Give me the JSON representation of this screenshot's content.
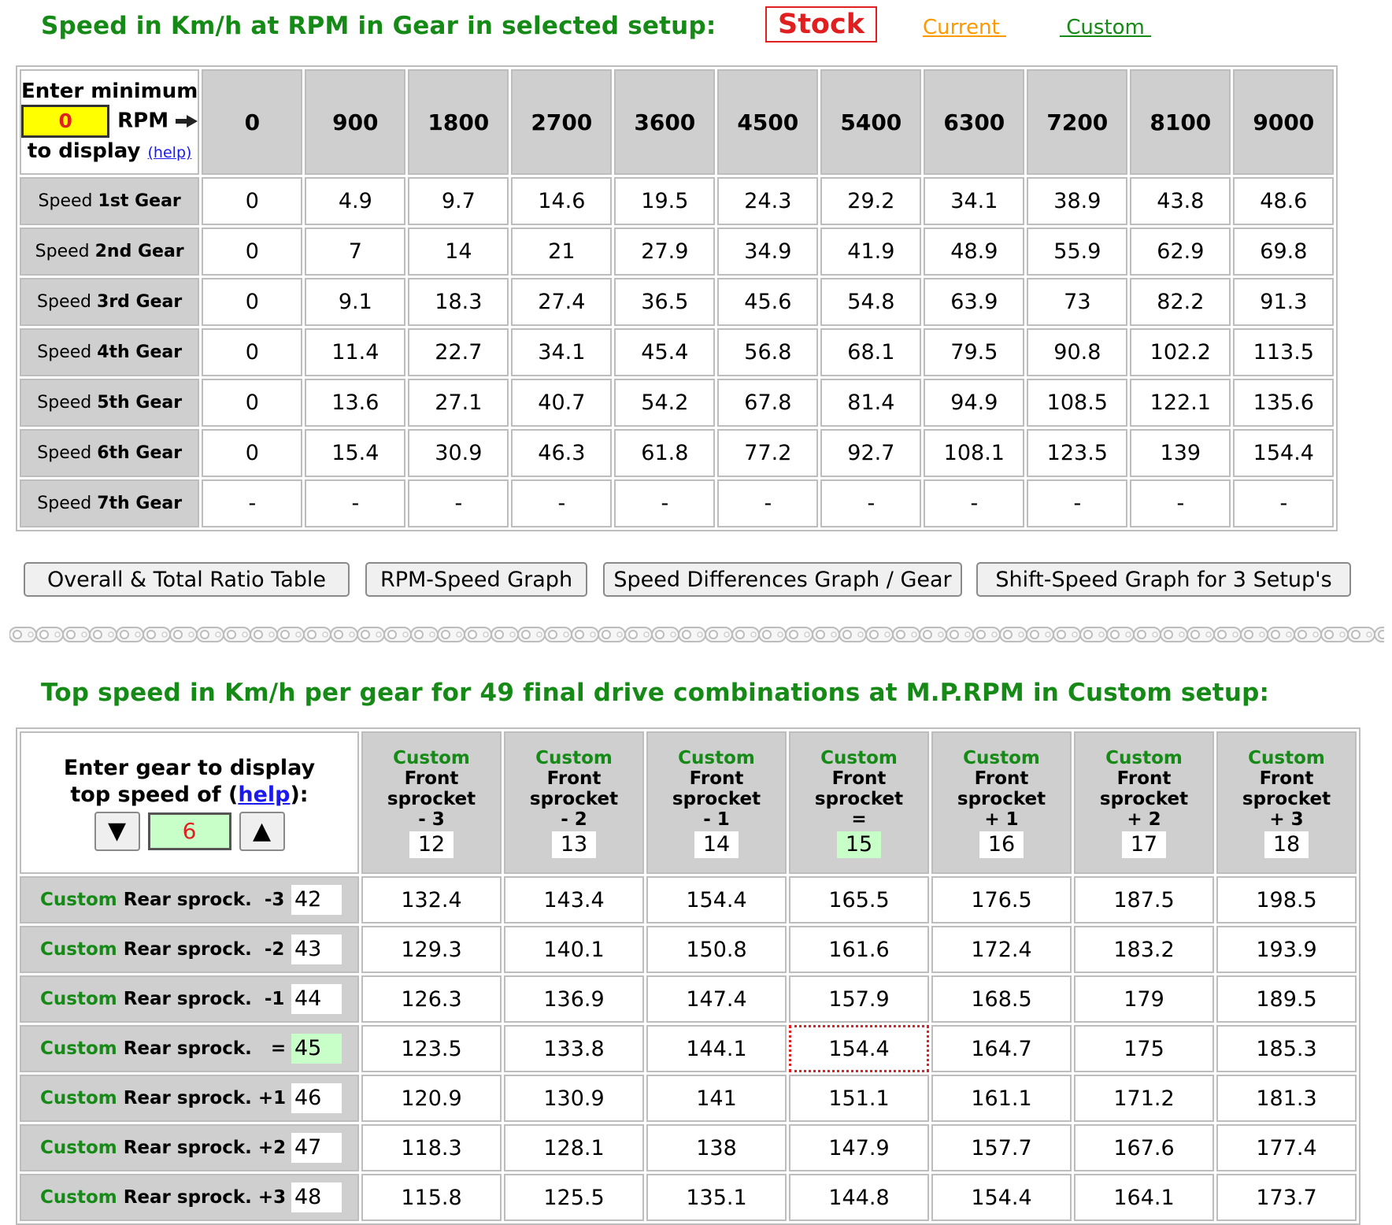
{
  "section1": {
    "title": "Speed in Km/h at RPM in Gear in selected setup:",
    "setups": {
      "selected": "Stock",
      "current": "Current ",
      "custom": " Custom "
    },
    "corner": {
      "line1": "Enter minimum",
      "rpm_value": "0",
      "rpm_label": "RPM",
      "line3": "to display",
      "help": "(help)"
    },
    "rpm_headers": [
      "0",
      "900",
      "1800",
      "2700",
      "3600",
      "4500",
      "5400",
      "6300",
      "7200",
      "8100",
      "9000"
    ],
    "rows": [
      {
        "prefix": "Speed ",
        "gear": "1st Gear",
        "values": [
          "0",
          "4.9",
          "9.7",
          "14.6",
          "19.5",
          "24.3",
          "29.2",
          "34.1",
          "38.9",
          "43.8",
          "48.6"
        ]
      },
      {
        "prefix": "Speed ",
        "gear": "2nd Gear",
        "values": [
          "0",
          "7",
          "14",
          "21",
          "27.9",
          "34.9",
          "41.9",
          "48.9",
          "55.9",
          "62.9",
          "69.8"
        ]
      },
      {
        "prefix": "Speed ",
        "gear": "3rd Gear",
        "values": [
          "0",
          "9.1",
          "18.3",
          "27.4",
          "36.5",
          "45.6",
          "54.8",
          "63.9",
          "73",
          "82.2",
          "91.3"
        ]
      },
      {
        "prefix": "Speed ",
        "gear": "4th Gear",
        "values": [
          "0",
          "11.4",
          "22.7",
          "34.1",
          "45.4",
          "56.8",
          "68.1",
          "79.5",
          "90.8",
          "102.2",
          "113.5"
        ]
      },
      {
        "prefix": "Speed ",
        "gear": "5th Gear",
        "values": [
          "0",
          "13.6",
          "27.1",
          "40.7",
          "54.2",
          "67.8",
          "81.4",
          "94.9",
          "108.5",
          "122.1",
          "135.6"
        ]
      },
      {
        "prefix": "Speed ",
        "gear": "6th Gear",
        "values": [
          "0",
          "15.4",
          "30.9",
          "46.3",
          "61.8",
          "77.2",
          "92.7",
          "108.1",
          "123.5",
          "139",
          "154.4"
        ]
      },
      {
        "prefix": "Speed ",
        "gear": "7th Gear",
        "values": [
          "-",
          "-",
          "-",
          "-",
          "-",
          "-",
          "-",
          "-",
          "-",
          "-",
          "-"
        ]
      }
    ]
  },
  "buttons": {
    "ratio_table": "Overall & Total Ratio Table",
    "rpm_speed_graph": "RPM-Speed Graph",
    "speed_diff_graph": "Speed Differences Graph / Gear",
    "shift_speed_graph": "Shift-Speed Graph for 3 Setup's"
  },
  "section2": {
    "title": "Top speed in Km/h per gear for 49 final drive combinations at M.P.RPM in Custom setup:",
    "corner": {
      "line1": "Enter gear to display",
      "line2_pre": "top speed of (",
      "help": "help",
      "line2_post": "):",
      "down": "▼",
      "gear_value": "6",
      "up": "▲"
    },
    "columns": [
      {
        "custom": "Custom",
        "line1": "Front",
        "line2": "sprocket",
        "offset": "- 3",
        "teeth": "12",
        "highlight": false
      },
      {
        "custom": "Custom",
        "line1": "Front",
        "line2": "sprocket",
        "offset": "- 2",
        "teeth": "13",
        "highlight": false
      },
      {
        "custom": "Custom",
        "line1": "Front",
        "line2": "sprocket",
        "offset": "- 1",
        "teeth": "14",
        "highlight": false
      },
      {
        "custom": "Custom",
        "line1": "Front",
        "line2": "sprocket",
        "offset": "=",
        "teeth": "15",
        "highlight": true
      },
      {
        "custom": "Custom",
        "line1": "Front",
        "line2": "sprocket",
        "offset": "+ 1",
        "teeth": "16",
        "highlight": false
      },
      {
        "custom": "Custom",
        "line1": "Front",
        "line2": "sprocket",
        "offset": "+ 2",
        "teeth": "17",
        "highlight": false
      },
      {
        "custom": "Custom",
        "line1": "Front",
        "line2": "sprocket",
        "offset": "+ 3",
        "teeth": "18",
        "highlight": false
      }
    ],
    "rows": [
      {
        "custom": "Custom",
        "label": "Rear sprock.  -3",
        "teeth": "42",
        "highlight": false,
        "values": [
          "132.4",
          "143.4",
          "154.4",
          "165.5",
          "176.5",
          "187.5",
          "198.5"
        ]
      },
      {
        "custom": "Custom",
        "label": "Rear sprock.  -2",
        "teeth": "43",
        "highlight": false,
        "values": [
          "129.3",
          "140.1",
          "150.8",
          "161.6",
          "172.4",
          "183.2",
          "193.9"
        ]
      },
      {
        "custom": "Custom",
        "label": "Rear sprock.  -1",
        "teeth": "44",
        "highlight": false,
        "values": [
          "126.3",
          "136.9",
          "147.4",
          "157.9",
          "168.5",
          "179",
          "189.5"
        ]
      },
      {
        "custom": "Custom",
        "label": "Rear sprock.   =",
        "teeth": "45",
        "highlight": true,
        "values": [
          "123.5",
          "133.8",
          "144.1",
          "154.4",
          "164.7",
          "175",
          "185.3"
        ]
      },
      {
        "custom": "Custom",
        "label": "Rear sprock. +1",
        "teeth": "46",
        "highlight": false,
        "values": [
          "120.9",
          "130.9",
          "141",
          "151.1",
          "161.1",
          "171.2",
          "181.3"
        ]
      },
      {
        "custom": "Custom",
        "label": "Rear sprock. +2",
        "teeth": "47",
        "highlight": false,
        "values": [
          "118.3",
          "128.1",
          "138",
          "147.9",
          "157.7",
          "167.6",
          "177.4"
        ]
      },
      {
        "custom": "Custom",
        "label": "Rear sprock. +3",
        "teeth": "48",
        "highlight": false,
        "values": [
          "115.8",
          "125.5",
          "135.1",
          "144.8",
          "154.4",
          "164.1",
          "173.7"
        ]
      }
    ],
    "selected_cell": {
      "row": 3,
      "col": 3
    }
  },
  "colors": {
    "green_text": "#168a16",
    "red": "#e02020",
    "orange_link": "#ff9900",
    "header_gray": "#cfcfcf",
    "highlight_green": "#c8ffc8",
    "rpm_yellow": "#ffff00"
  }
}
